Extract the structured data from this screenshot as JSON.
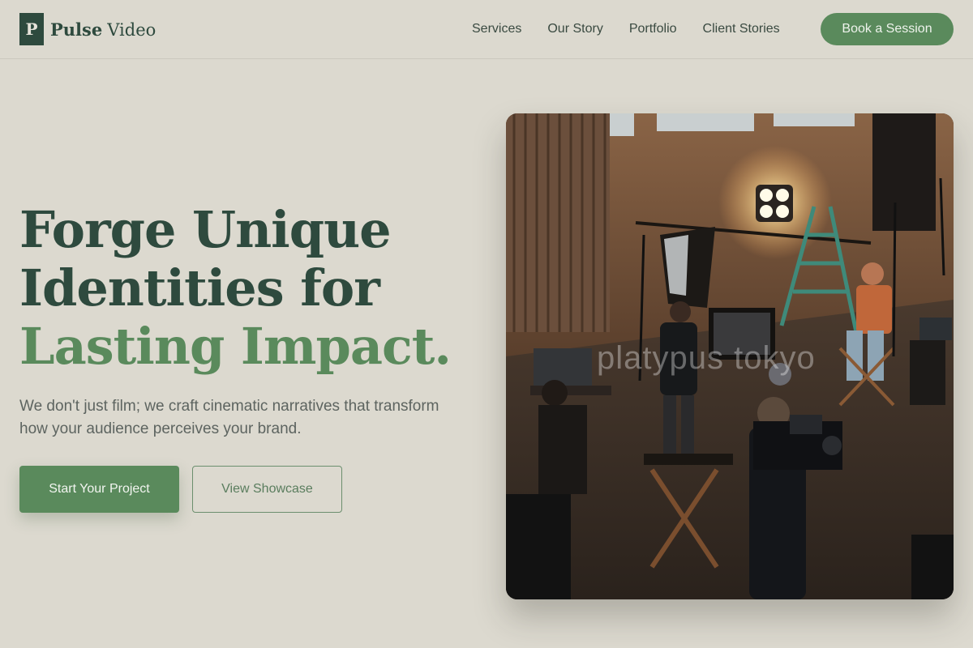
{
  "header": {
    "logo_mark": "P",
    "logo_bold": "Pulse",
    "logo_regular": "Video",
    "nav": [
      "Services",
      "Our Story",
      "Portfolio",
      "Client Stories"
    ],
    "cta_label": "Book a Session"
  },
  "hero": {
    "title_line1": "Forge Unique",
    "title_line2": "Identities for",
    "title_line3": "Lasting Impact.",
    "subtitle": "We don't just film; we craft cinematic narratives that transform how your audience perceives your brand.",
    "primary_button": "Start Your Project",
    "secondary_button": "View Showcase"
  },
  "image": {
    "subject": "film-set-photo",
    "watermark": "platypus tokyo"
  },
  "colors": {
    "background": "#dcd9cf",
    "primary_green": "#5a8a5c",
    "dark_green": "#2e4a3e"
  }
}
